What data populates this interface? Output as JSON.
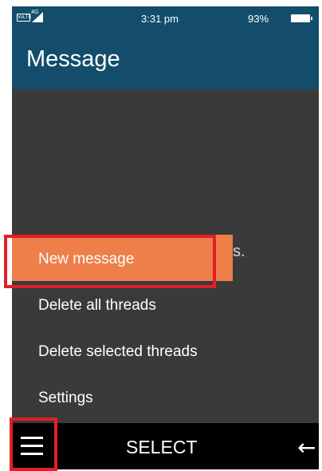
{
  "status_bar": {
    "volte": "VoLTE",
    "network": "4G",
    "time": "3:31 pm",
    "battery": "93%"
  },
  "header": {
    "title": "Message"
  },
  "background": {
    "partial_text": "s."
  },
  "menu": {
    "items": [
      {
        "label": "New message",
        "selected": true
      },
      {
        "label": "Delete all threads",
        "selected": false
      },
      {
        "label": "Delete selected threads",
        "selected": false
      },
      {
        "label": "Settings",
        "selected": false
      }
    ]
  },
  "softkeys": {
    "left_icon": "hamburger-menu-icon",
    "center_label": "SELECT",
    "right_icon": "back-arrow-icon"
  },
  "colors": {
    "header_bg": "#134d6b",
    "menu_bg": "#3a3a3a",
    "selected_bg": "#ee7f4a",
    "highlight_border": "#e31e24",
    "softkey_bg": "#000000"
  },
  "annotations": {
    "highlighted_items": [
      "new-message-menu-item",
      "options-menu-softkey"
    ]
  }
}
